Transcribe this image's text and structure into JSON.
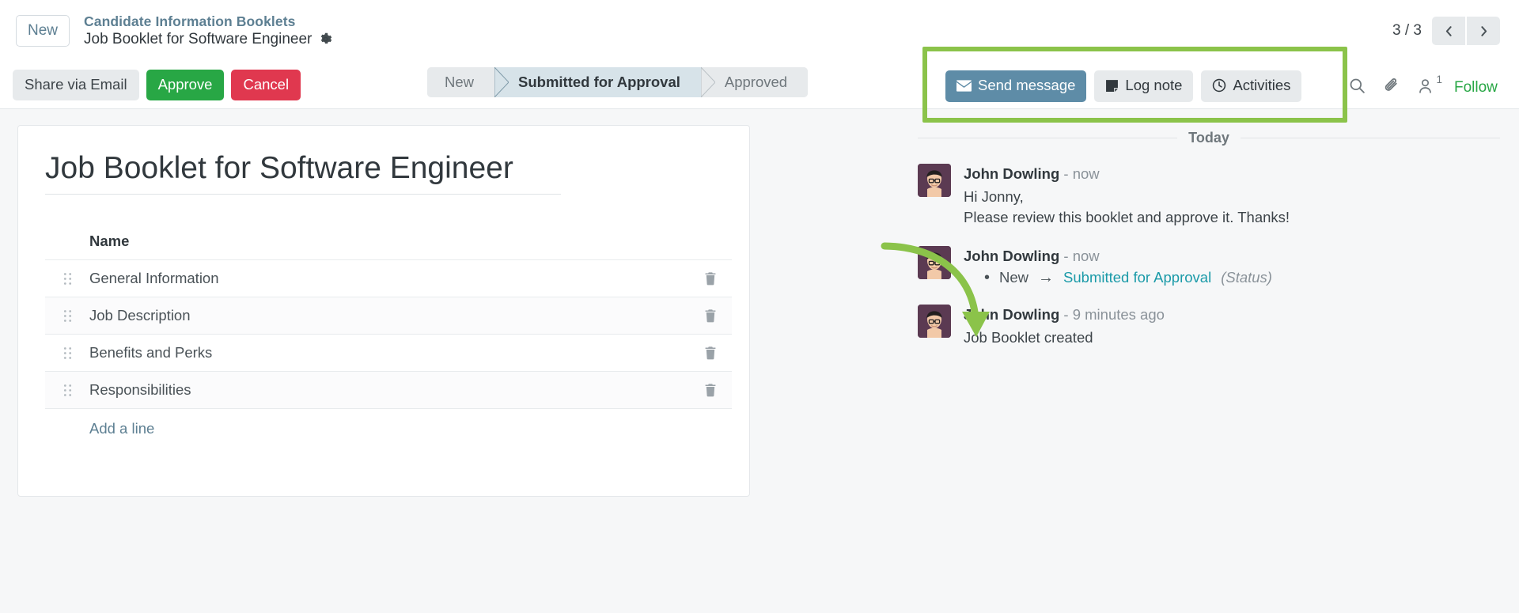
{
  "topbar": {
    "new_badge": "New",
    "breadcrumb_parent": "Candidate Information Booklets",
    "breadcrumb_current": "Job Booklet for Software Engineer",
    "settings_icon": "gear-icon",
    "pager_count": "3 / 3",
    "prev_icon": "chevron-left-icon",
    "next_icon": "chevron-right-icon"
  },
  "controlbar": {
    "share_label": "Share via Email",
    "approve_label": "Approve",
    "cancel_label": "Cancel",
    "stages": [
      {
        "label": "New",
        "active": false
      },
      {
        "label": "Submitted for Approval",
        "active": true
      },
      {
        "label": "Approved",
        "active": false
      }
    ]
  },
  "chatter_actions": {
    "send_message_label": "Send message",
    "send_message_icon": "envelope-icon",
    "log_note_label": "Log note",
    "log_note_icon": "sticky-note-icon",
    "activities_label": "Activities",
    "activities_icon": "clock-icon",
    "search_icon": "search-icon",
    "attachment_icon": "paperclip-icon",
    "followers_icon": "user-icon",
    "followers_count": "1",
    "follow_label": "Follow"
  },
  "form": {
    "record_title": "Job Booklet for Software Engineer",
    "column_header": "Name",
    "rows": [
      {
        "name": "General Information",
        "drag_icon": "drag-handle-icon",
        "delete_icon": "trash-icon"
      },
      {
        "name": "Job Description",
        "drag_icon": "drag-handle-icon",
        "delete_icon": "trash-icon"
      },
      {
        "name": "Benefits and Perks",
        "drag_icon": "drag-handle-icon",
        "delete_icon": "trash-icon"
      },
      {
        "name": "Responsibilities",
        "drag_icon": "drag-handle-icon",
        "delete_icon": "trash-icon"
      }
    ],
    "add_line_label": "Add a line"
  },
  "chatter": {
    "day_label": "Today",
    "messages": [
      {
        "author": "John Dowling",
        "time": "- now",
        "line1": "Hi Jonny,",
        "line2": "Please review this booklet and approve it. Thanks!"
      },
      {
        "author": "John Dowling",
        "time": "- now",
        "track_bullet": "•",
        "track_from": "New",
        "track_arrow": "→",
        "track_to": "Submitted for Approval",
        "track_field": "(Status)"
      },
      {
        "author": "John Dowling",
        "time": "- 9 minutes ago",
        "line1": "Job Booklet created"
      }
    ]
  },
  "annotations": {
    "highlight_color": "#8bc34a",
    "highlight_target": "chatter-action-buttons",
    "arrow_icon": "curved-arrow-icon"
  }
}
